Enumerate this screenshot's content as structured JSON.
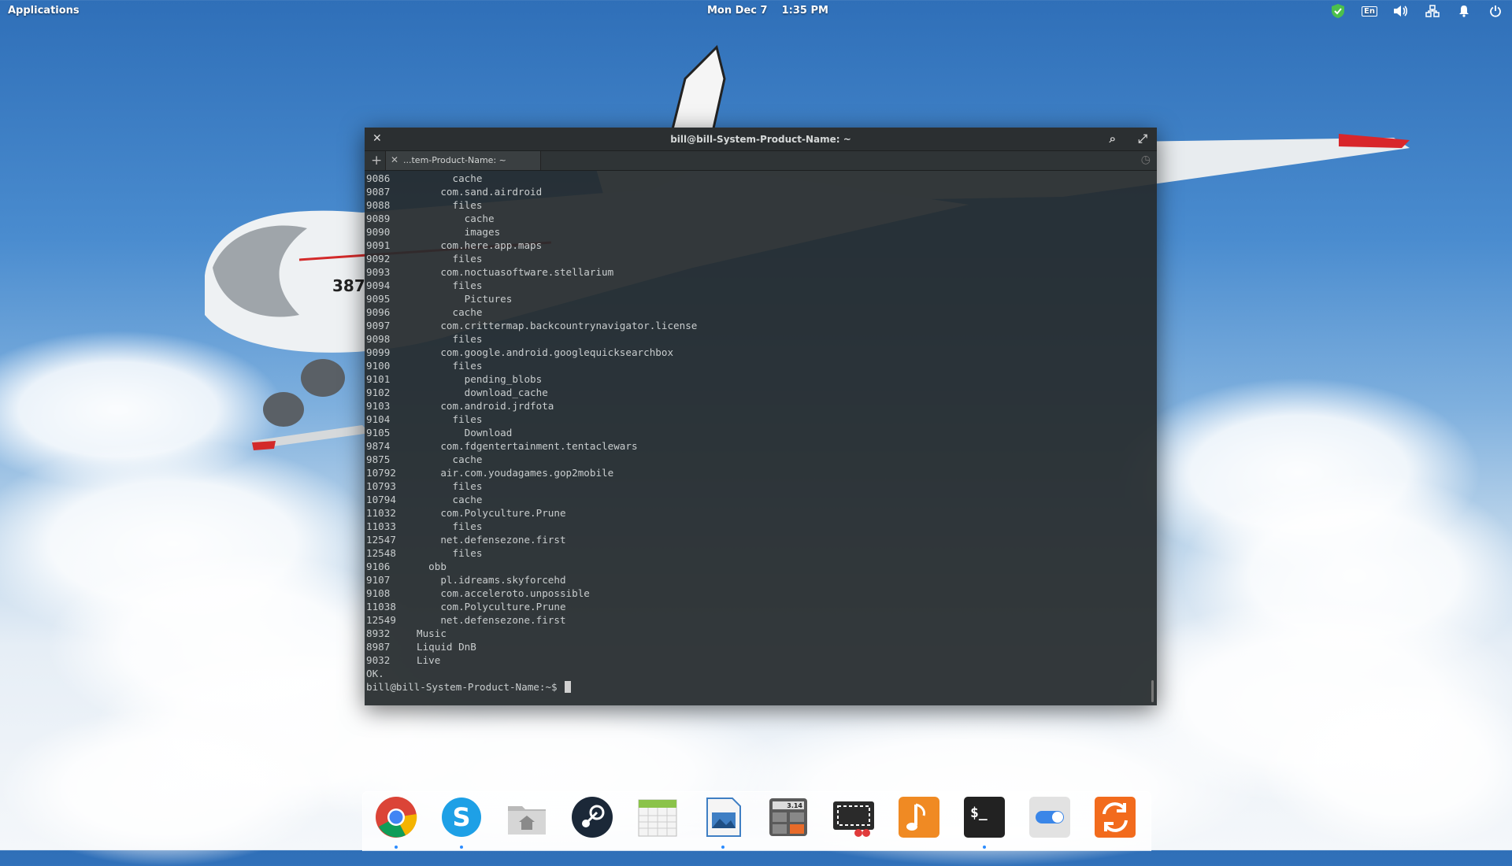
{
  "panel": {
    "applications_label": "Applications",
    "clock": "Mon Dec 7    1:35 PM",
    "keyboard_layout": "En"
  },
  "terminal": {
    "window_title": "bill@bill-System-Product-Name: ~",
    "tab_label": "...tem-Product-Name: ~",
    "lines": [
      {
        "n": "9086",
        "t": "      cache"
      },
      {
        "n": "9087",
        "t": "    com.sand.airdroid"
      },
      {
        "n": "9088",
        "t": "      files"
      },
      {
        "n": "9089",
        "t": "        cache"
      },
      {
        "n": "9090",
        "t": "        images"
      },
      {
        "n": "9091",
        "t": "    com.here.app.maps"
      },
      {
        "n": "9092",
        "t": "      files"
      },
      {
        "n": "9093",
        "t": "    com.noctuasoftware.stellarium"
      },
      {
        "n": "9094",
        "t": "      files"
      },
      {
        "n": "9095",
        "t": "        Pictures"
      },
      {
        "n": "9096",
        "t": "      cache"
      },
      {
        "n": "9097",
        "t": "    com.crittermap.backcountrynavigator.license"
      },
      {
        "n": "9098",
        "t": "      files"
      },
      {
        "n": "9099",
        "t": "    com.google.android.googlequicksearchbox"
      },
      {
        "n": "9100",
        "t": "      files"
      },
      {
        "n": "9101",
        "t": "        pending_blobs"
      },
      {
        "n": "9102",
        "t": "        download_cache"
      },
      {
        "n": "9103",
        "t": "    com.android.jrdfota"
      },
      {
        "n": "9104",
        "t": "      files"
      },
      {
        "n": "9105",
        "t": "        Download"
      },
      {
        "n": "9874",
        "t": "    com.fdgentertainment.tentaclewars"
      },
      {
        "n": "9875",
        "t": "      cache"
      },
      {
        "n": "10792",
        "t": "    air.com.youdagames.gop2mobile"
      },
      {
        "n": "10793",
        "t": "      files"
      },
      {
        "n": "10794",
        "t": "      cache"
      },
      {
        "n": "11032",
        "t": "    com.Polyculture.Prune"
      },
      {
        "n": "11033",
        "t": "      files"
      },
      {
        "n": "12547",
        "t": "    net.defensezone.first"
      },
      {
        "n": "12548",
        "t": "      files"
      },
      {
        "n": "9106",
        "t": "  obb"
      },
      {
        "n": "9107",
        "t": "    pl.idreams.skyforcehd"
      },
      {
        "n": "9108",
        "t": "    com.acceleroto.unpossible"
      },
      {
        "n": "11038",
        "t": "    com.Polyculture.Prune"
      },
      {
        "n": "12549",
        "t": "    net.defensezone.first"
      },
      {
        "n": "8932",
        "t": "Music"
      },
      {
        "n": "8987",
        "t": "Liquid DnB"
      },
      {
        "n": "9032",
        "t": "Live"
      }
    ],
    "status_line": "OK.",
    "prompt": "bill@bill-System-Product-Name:~$ "
  },
  "dock": {
    "apps": [
      {
        "name": "Chrome",
        "icon": "chrome-icon",
        "color": "#e34133",
        "running": true
      },
      {
        "name": "Skype",
        "icon": "skype-icon",
        "color": "#1ea0e6",
        "running": true
      },
      {
        "name": "Files",
        "icon": "home-folder-icon",
        "color": "#cfcfcf",
        "running": false
      },
      {
        "name": "Steam",
        "icon": "steam-icon",
        "color": "#1b2838",
        "running": false
      },
      {
        "name": "Calendar",
        "icon": "calendar-icon",
        "color": "#f2f2f2",
        "running": false
      },
      {
        "name": "Photos",
        "icon": "image-viewer-icon",
        "color": "#3f7fc4",
        "running": true
      },
      {
        "name": "Calculator",
        "icon": "calculator-icon",
        "color": "#555555",
        "running": false
      },
      {
        "name": "Screenshot",
        "icon": "screenshot-icon",
        "color": "#2a2a2a",
        "running": false
      },
      {
        "name": "Music",
        "icon": "music-icon",
        "color": "#f08a23",
        "running": false
      },
      {
        "name": "Terminal",
        "icon": "terminal-icon",
        "color": "#222222",
        "running": true
      },
      {
        "name": "Settings",
        "icon": "toggle-settings-icon",
        "color": "#dcdcdc",
        "running": false
      },
      {
        "name": "Updates",
        "icon": "sync-icon",
        "color": "#f26b1d",
        "running": false
      }
    ],
    "calc_display": "3.14",
    "terminal_glyph": "$_"
  }
}
